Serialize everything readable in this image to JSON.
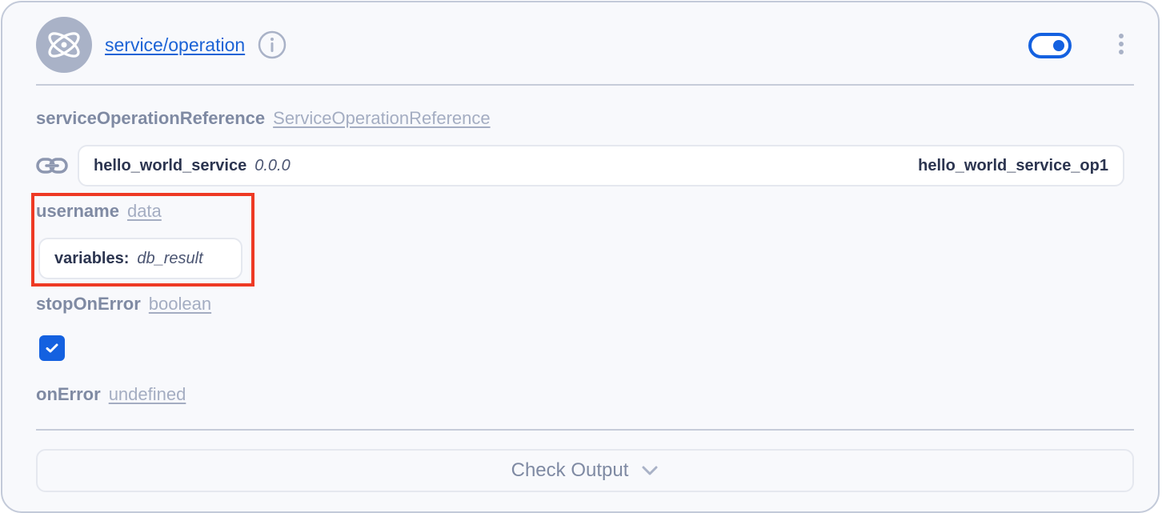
{
  "header": {
    "operation_link": "service/operation",
    "avatar_icon": "atom-icon",
    "info_icon": "info-icon",
    "toggle_state": "on",
    "menu_icon": "vertical-ellipsis-icon"
  },
  "fields": {
    "service_ref": {
      "name": "serviceOperationReference",
      "type": "ServiceOperationReference",
      "service_name": "hello_world_service",
      "service_version": "0.0.0",
      "operation_name": "hello_world_service_op1"
    },
    "username": {
      "name": "username",
      "type": "data",
      "key": "variables:",
      "value": "db_result"
    },
    "stop_on_error": {
      "name": "stopOnError",
      "type": "boolean",
      "checked": true
    },
    "on_error": {
      "name": "onError",
      "type": "undefined"
    }
  },
  "footer": {
    "check_output_label": "Check Output"
  },
  "colors": {
    "accent": "#1461e0",
    "highlight": "#ee3a24",
    "label": "#7f8aa3"
  }
}
